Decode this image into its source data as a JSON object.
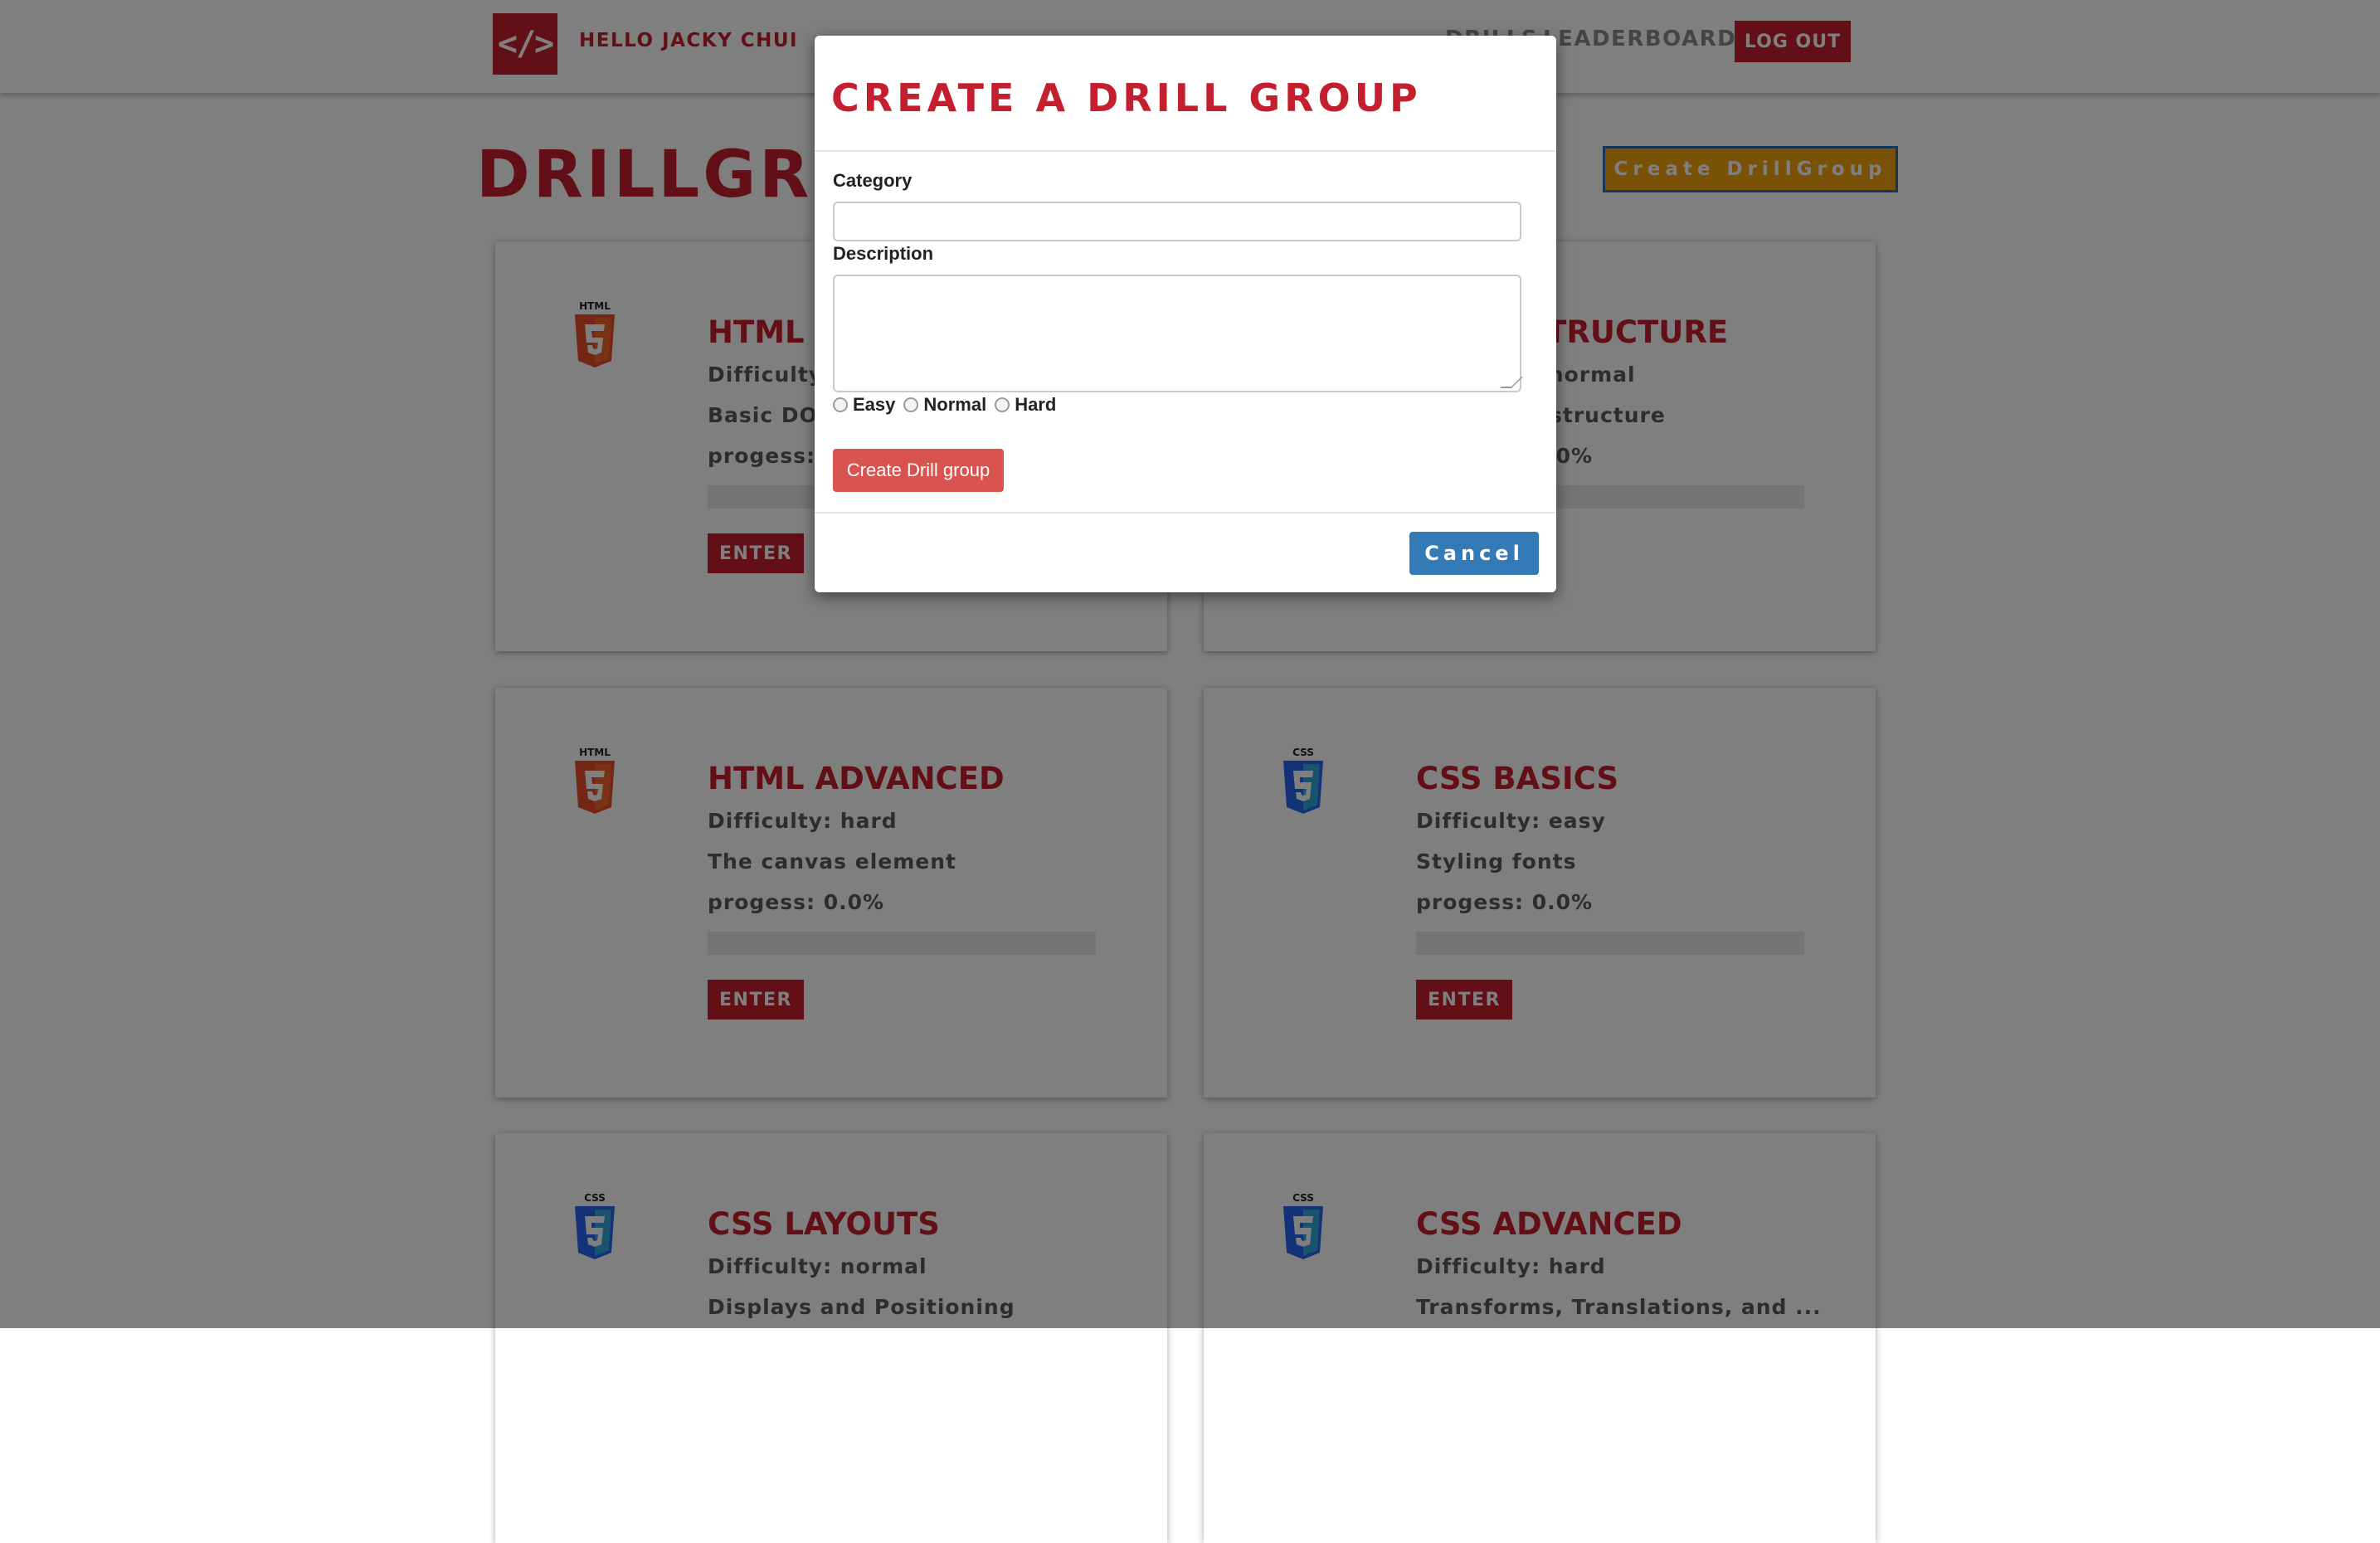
{
  "header": {
    "logo_text": "</>",
    "greeting": "HELLO JACKY CHUI",
    "nav": {
      "drills": "DRILLS",
      "leaderboard": "LEADERBOARD"
    },
    "logout_label": "LOG OUT"
  },
  "page": {
    "title": "DRILLGROUPS",
    "create_button_label": "Create DrillGroup"
  },
  "cards": [
    {
      "icon": "html5-icon",
      "title": "HTML TAGS",
      "difficulty": "Difficulty: easy",
      "description": "Basic DOM elements",
      "progress_text": "progess: 0.0%",
      "progress": 0,
      "enter_label": "ENTER"
    },
    {
      "icon": "html5-icon",
      "title": "HTML STRUCTURE",
      "difficulty": "Difficulty: normal",
      "description": "Document structure",
      "progress_text": "progess: 0.0%",
      "progress": 0,
      "enter_label": "ENTER"
    },
    {
      "icon": "html5-icon",
      "title": "HTML ADVANCED",
      "difficulty": "Difficulty: hard",
      "description": "The canvas element",
      "progress_text": "progess: 0.0%",
      "progress": 0,
      "enter_label": "ENTER"
    },
    {
      "icon": "css3-icon",
      "title": "CSS BASICS",
      "difficulty": "Difficulty: easy",
      "description": "Styling fonts",
      "progress_text": "progess: 0.0%",
      "progress": 0,
      "enter_label": "ENTER"
    },
    {
      "icon": "css3-icon",
      "title": "CSS LAYOUTS",
      "difficulty": "Difficulty: normal",
      "description": "Displays and Positioning",
      "progress_text": "",
      "progress": 0,
      "enter_label": ""
    },
    {
      "icon": "css3-icon",
      "title": "CSS ADVANCED",
      "difficulty": "Difficulty: hard",
      "description": "Transforms, Translations, and ...",
      "progress_text": "",
      "progress": 0,
      "enter_label": ""
    }
  ],
  "modal": {
    "title": "CREATE A DRILL GROUP",
    "category_label": "Category",
    "category_value": "",
    "description_label": "Description",
    "description_value": "",
    "difficulty_options": [
      "Easy",
      "Normal",
      "Hard"
    ],
    "submit_label": "Create Drill group",
    "cancel_label": "Cancel"
  },
  "colors": {
    "brand_red": "#c41f2f",
    "create_drillgroup_bg": "#f2a20f",
    "create_group_btn": "#d9534f",
    "cancel_btn": "#337ab7",
    "html5_orange": "#e44d26",
    "css3_blue": "#2965f1"
  }
}
